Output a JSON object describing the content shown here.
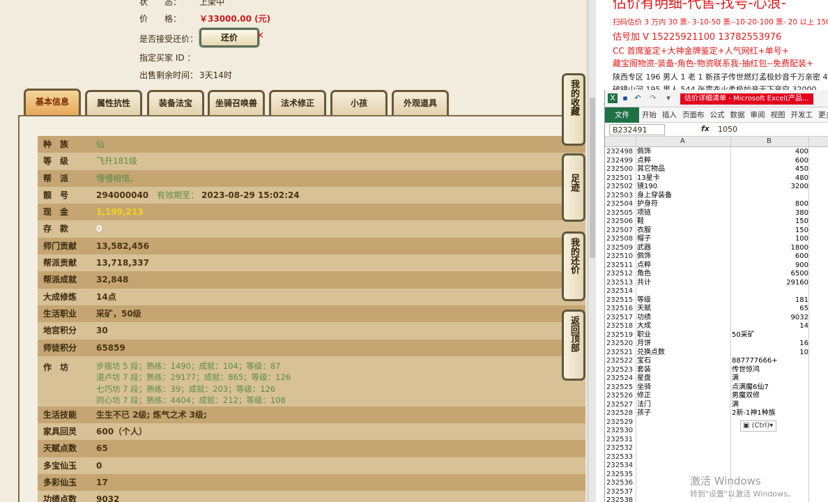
{
  "top": {
    "status_label": "状　　态：",
    "status_value": "上架中",
    "price_label": "价　　格：",
    "price_value": "￥33000.00 (元)",
    "counter_label": "是否接受还价：",
    "counter_button": "还价",
    "close_mark": "✕",
    "buyer_label": "指定买家 ID ：",
    "time_label": "出售剩余时间：",
    "time_value": "3天14时"
  },
  "tabs": [
    "基本信息",
    "属性抗性",
    "装备法宝",
    "坐骑召唤兽",
    "法术修正",
    "小孩",
    "外观道具"
  ],
  "side_buttons": [
    "我的收藏",
    "足迹",
    "我的还价",
    "返回顶部"
  ],
  "rows": [
    {
      "k": "种　族",
      "v": "仙"
    },
    {
      "k": "等　级",
      "v": "飞升181级"
    },
    {
      "k": "帮　派",
      "v": "懵懵相惜。"
    },
    {
      "k": "靓　号",
      "v": "294000040",
      "extra": "有效期至：",
      "extra2": "2023-08-29 15:02:24"
    },
    {
      "k": "现　金",
      "v": "1,199,213"
    },
    {
      "k": "存　款",
      "v": "0"
    },
    {
      "k": "师门贡献",
      "v": "13,582,456"
    },
    {
      "k": "帮派贡献",
      "v": "13,718,337"
    },
    {
      "k": "帮派成就",
      "v": "32,848"
    },
    {
      "k": "大成修炼",
      "v": "14点"
    },
    {
      "k": "生活职业",
      "v": "采矿，50级"
    },
    {
      "k": "地宫积分",
      "v": "30"
    },
    {
      "k": "师徒积分",
      "v": "65859"
    }
  ],
  "workshop": {
    "k": "作　坊",
    "lines": [
      "步摇坊 5 段；熟练：1490；成就：104；等级：87",
      "湛卢坊 7 段；熟练：29177；成就：865；等级：126",
      "七巧坊 7 段；熟练：39；成就：203；等级：126",
      "同心坊 7 段；熟练：4404；成就：212；等级：108"
    ]
  },
  "rows2": [
    {
      "k": "生活技能",
      "v": "生生不已 2级; 炼气之术 3级;"
    },
    {
      "k": "家具回灵",
      "v": "600（个人）"
    },
    {
      "k": "天赋点数",
      "v": "65"
    },
    {
      "k": "多宝仙玉",
      "v": "0"
    },
    {
      "k": "多彩仙玉",
      "v": "17"
    },
    {
      "k": "功绩点数",
      "v": "9032"
    }
  ],
  "ads": [
    "估价有明细-代售-找号-心浪-",
    "扫码估价 3 万内 30 票- 3-10-50 票--10-20-100 票- 20 以上 150-",
    "估号加 V 15225921100 13782553976",
    "CC 首席鉴定+大神金牌鉴定+人气网红+单号+",
    "藏宝阁物资-装备-角色-物资联系我-抽红包--免费配装+",
    "陕西专区 196 男人 1 老 1 新孩子传世燃灯孟极妙音千万亲密 4",
    "破镜山河 195 男人 544 张震衣火柔极妙音无下音空 32000"
  ],
  "excel": {
    "title": "估价详细清单 - Microsoft Excel(产品...",
    "ribbon": [
      "文件",
      "开始",
      "插入",
      "页面布",
      "公式",
      "数据",
      "审阅",
      "视图",
      "开发工",
      "更多"
    ],
    "namebox": "B232491",
    "fx": "fx",
    "formula_value": "1050",
    "col_a": "A",
    "col_b": "B",
    "rows": [
      [
        "232498",
        "佩饰",
        "400"
      ],
      [
        "232499",
        "点粹",
        "600"
      ],
      [
        "232500",
        "其它物品",
        "450"
      ],
      [
        "232501",
        "13星卡",
        "480"
      ],
      [
        "232502",
        "镜190",
        "3200"
      ],
      [
        "232503",
        "身上穿装备",
        ""
      ],
      [
        "232504",
        "护身符",
        "800"
      ],
      [
        "232505",
        "项链",
        "380"
      ],
      [
        "232506",
        "鞋",
        "150"
      ],
      [
        "232507",
        "衣服",
        "150"
      ],
      [
        "232508",
        "帽子",
        "100"
      ],
      [
        "232509",
        "武器",
        "1800"
      ],
      [
        "232510",
        "佩饰",
        "600"
      ],
      [
        "232511",
        "点粹",
        "900"
      ],
      [
        "232512",
        "角色",
        "6500"
      ],
      [
        "232513",
        "共计",
        "29160"
      ],
      [
        "232514",
        "",
        ""
      ],
      [
        "232515",
        "等级",
        "181"
      ],
      [
        "232516",
        "天赋",
        "65"
      ],
      [
        "232517",
        "功绩",
        "9032"
      ],
      [
        "232518",
        "大成",
        "14"
      ],
      [
        "232519",
        "职业",
        "50采矿"
      ],
      [
        "232520",
        "月饼",
        "16"
      ],
      [
        "232521",
        "兑换点数",
        "10"
      ],
      [
        "232522",
        "宝石",
        "887777666+"
      ],
      [
        "232523",
        "套装",
        "传世惊鸿"
      ],
      [
        "232524",
        "星盘",
        "满"
      ],
      [
        "232525",
        "坐骑",
        "点满魔6仙7"
      ],
      [
        "232526",
        "修正",
        "男魔双修"
      ],
      [
        "232527",
        "法门",
        "满"
      ],
      [
        "232528",
        "孩子",
        "2新-1神1种族"
      ],
      [
        "232529",
        "",
        ""
      ],
      [
        "232530",
        "",
        ""
      ],
      [
        "232531",
        "",
        ""
      ],
      [
        "232532",
        "",
        ""
      ],
      [
        "232533",
        "",
        ""
      ],
      [
        "232534",
        "",
        ""
      ],
      [
        "232535",
        "",
        ""
      ],
      [
        "232536",
        "",
        ""
      ],
      [
        "232537",
        "",
        ""
      ],
      [
        "232538",
        "",
        ""
      ]
    ],
    "paste": "(Ctrl)▾"
  },
  "watermark": {
    "line1": "激活 Windows",
    "line2": "转到\"设置\"以激活 Windows。"
  }
}
